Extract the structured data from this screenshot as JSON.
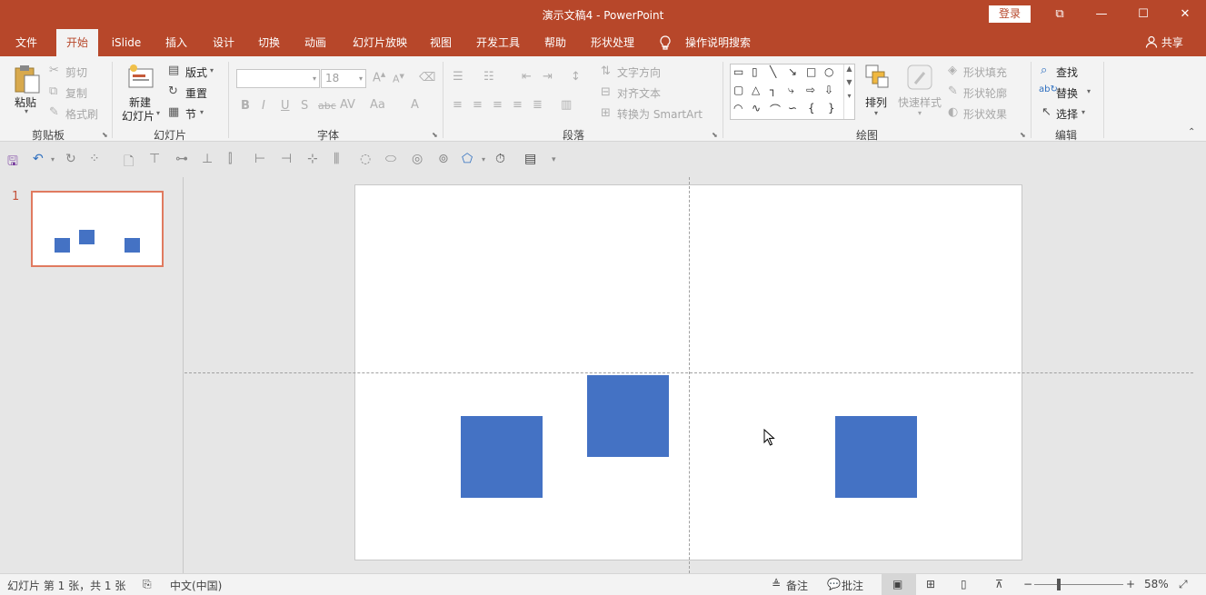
{
  "window": {
    "title": "演示文稿4  -  PowerPoint",
    "login": "登录",
    "controls": {
      "ribbon_display": "⧉",
      "minimize": "—",
      "maximize": "☐",
      "close": "✕"
    }
  },
  "tabs": [
    {
      "label": "文件",
      "active": false
    },
    {
      "label": "开始",
      "active": true
    },
    {
      "label": "iSlide",
      "active": false
    },
    {
      "label": "插入",
      "active": false
    },
    {
      "label": "设计",
      "active": false
    },
    {
      "label": "切换",
      "active": false
    },
    {
      "label": "动画",
      "active": false
    },
    {
      "label": "幻灯片放映",
      "active": false
    },
    {
      "label": "视图",
      "active": false
    },
    {
      "label": "开发工具",
      "active": false
    },
    {
      "label": "帮助",
      "active": false
    },
    {
      "label": "形状处理",
      "active": false
    }
  ],
  "tell_me": "操作说明搜索",
  "share": "共享",
  "ribbon": {
    "clipboard": {
      "label": "剪贴板",
      "paste": "粘贴",
      "cut": "剪切",
      "copy": "复制",
      "format_painter": "格式刷"
    },
    "slides": {
      "label": "幻灯片",
      "new_slide_1": "新建",
      "new_slide_2": "幻灯片",
      "layout": "版式",
      "reset": "重置",
      "section": "节"
    },
    "font": {
      "label": "字体",
      "font_name": "",
      "font_size": "18"
    },
    "paragraph": {
      "label": "段落",
      "text_direction": "文字方向",
      "align_text": "对齐文本",
      "convert_smartart": "转换为 SmartArt"
    },
    "drawing": {
      "label": "绘图",
      "arrange": "排列",
      "quick_styles": "快速样式",
      "shape_fill": "形状填充",
      "shape_outline": "形状轮廓",
      "shape_effects": "形状效果"
    },
    "editing": {
      "label": "编辑",
      "find": "查找",
      "replace": "替换",
      "select": "选择"
    }
  },
  "thumbnails": [
    {
      "number": "1"
    }
  ],
  "status": {
    "slide_info": "幻灯片 第 1 张，共 1 张",
    "language": "中文(中国)",
    "notes": "备注",
    "comments": "批注",
    "zoom": "58%"
  },
  "colors": {
    "accent": "#b7472a",
    "shape_fill": "#4472c4",
    "thumb_border": "#e07a5f"
  }
}
